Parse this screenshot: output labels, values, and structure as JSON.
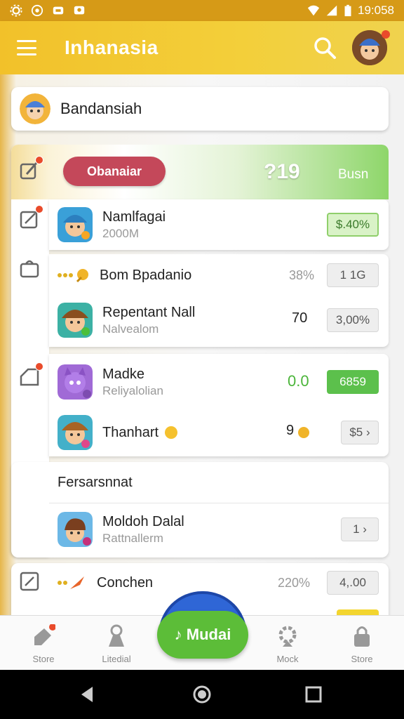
{
  "status_bar": {
    "time": "19:058"
  },
  "app_bar": {
    "title": "Inhanasia"
  },
  "user_card": {
    "name": "Bandansiah"
  },
  "banner": {
    "pill_label": "Obanaiar",
    "value": "?19",
    "label": "Busn"
  },
  "rows": [
    {
      "name": "Namlfagai",
      "subtitle": "2000M",
      "button": "$.40%"
    },
    {
      "name": "Bom Bpadanio",
      "mid": "38%",
      "button": "1 1G"
    },
    {
      "name": "Repentant Nall",
      "subtitle": "Nalvealom",
      "mid": "70",
      "button": "3,00%"
    },
    {
      "name": "Madke",
      "subtitle": "Reliyalolian",
      "mid": "0.0",
      "button": "6859"
    },
    {
      "name": "Thanhart",
      "mid": "9",
      "button": "$5 ›"
    }
  ],
  "section2": {
    "header": "Fersarsnnat"
  },
  "row6": {
    "name": "Moldoh Dalal",
    "subtitle": "Rattnallerm",
    "button": "1 ›"
  },
  "row7": {
    "name": "Conchen",
    "mid": "220%",
    "button": "4,.00"
  },
  "bottom_nav": {
    "items": [
      {
        "label": "Store"
      },
      {
        "label": "Litedial"
      },
      {
        "label": "Mock"
      },
      {
        "label": "Store"
      }
    ],
    "fab_label": "♪ Mudai"
  },
  "colors": {
    "accent": "#f2c12a",
    "green": "#5cc04c",
    "status_bar": "#d69a17"
  }
}
